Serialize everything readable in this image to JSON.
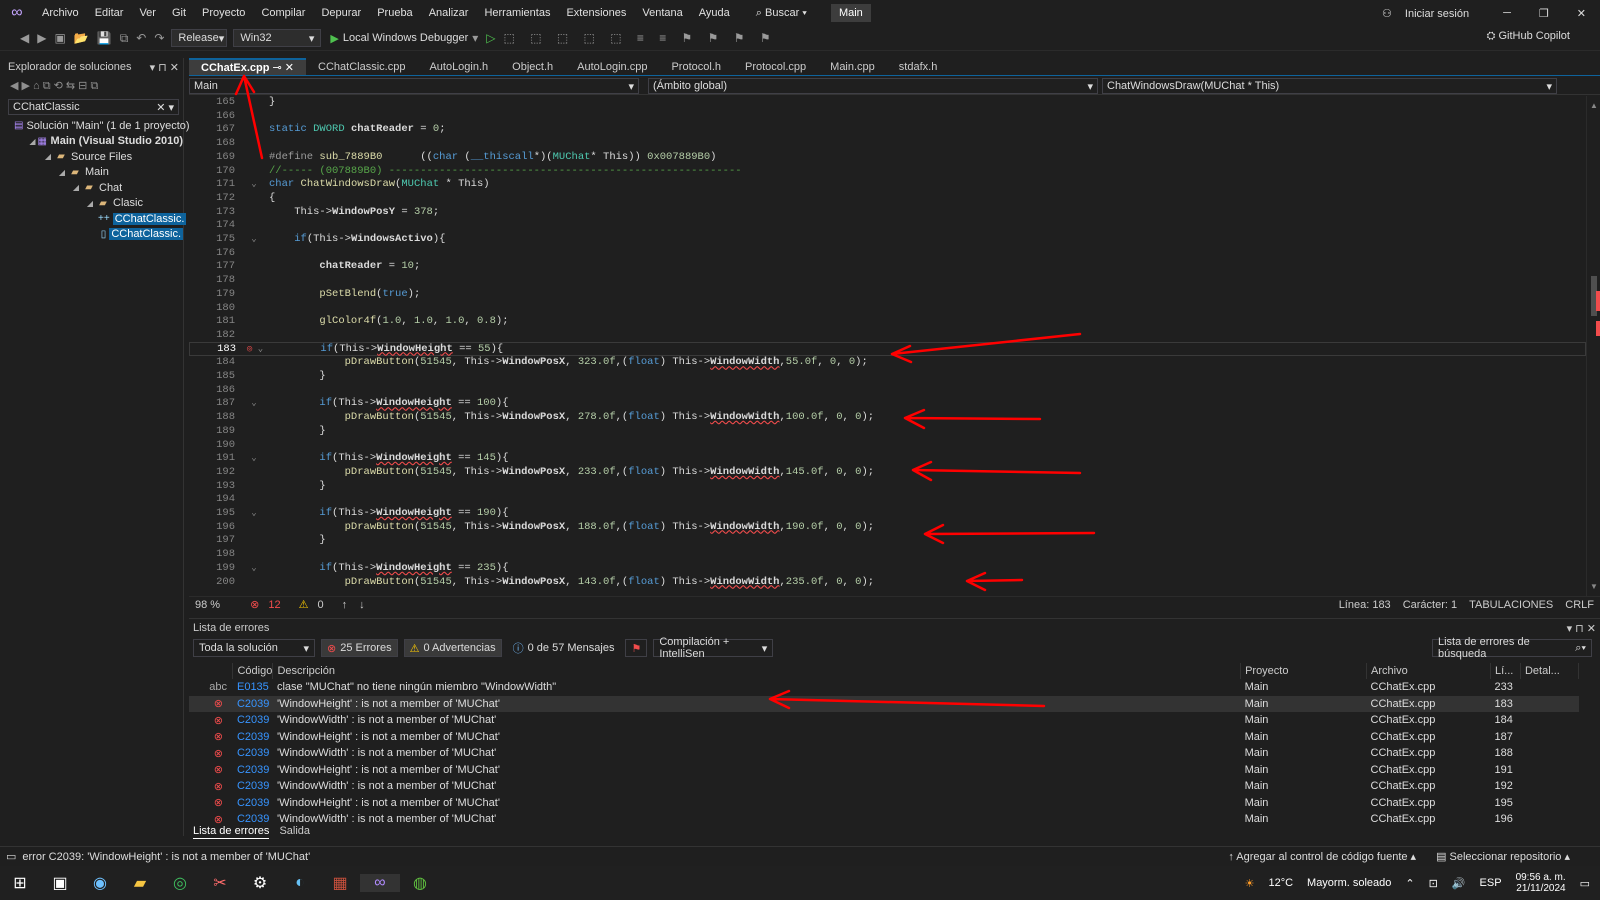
{
  "menubar": {
    "items": [
      "Archivo",
      "Editar",
      "Ver",
      "Git",
      "Proyecto",
      "Compilar",
      "Depurar",
      "Prueba",
      "Analizar",
      "Herramientas",
      "Extensiones",
      "Ventana",
      "Ayuda"
    ],
    "search": "Buscar",
    "solution": "Main",
    "signin": "Iniciar sesión"
  },
  "toolbar": {
    "config": "Release",
    "platform": "Win32",
    "debugger": "Local Windows Debugger",
    "copilot": "GitHub Copilot"
  },
  "sidebar": {
    "title": "Explorador de soluciones",
    "search_value": "CChatClassic",
    "tree": [
      {
        "label": "Solución \"Main\" (1 de 1 proyecto)",
        "indent": 0,
        "expander": "",
        "icon": "solution"
      },
      {
        "label": "Main (Visual Studio 2010)",
        "indent": 1,
        "expander": "◢",
        "icon": "project"
      },
      {
        "label": "Source Files",
        "indent": 2,
        "expander": "◢",
        "icon": "folder"
      },
      {
        "label": "Main",
        "indent": 3,
        "expander": "◢",
        "icon": "folder"
      },
      {
        "label": "Chat",
        "indent": 4,
        "expander": "◢",
        "icon": "folder"
      },
      {
        "label": "Clasic",
        "indent": 5,
        "expander": "◢",
        "icon": "folder"
      },
      {
        "label": "CChatClassic.",
        "indent": 6,
        "expander": "",
        "icon": "cpp",
        "selected": true
      },
      {
        "label": "CChatClassic.",
        "indent": 6,
        "expander": "",
        "icon": "h",
        "selected": true
      }
    ]
  },
  "tabs": [
    "CChatEx.cpp",
    "CChatClassic.cpp",
    "AutoLogin.h",
    "Object.h",
    "AutoLogin.cpp",
    "Protocol.h",
    "Protocol.cpp",
    "Main.cpp",
    "stdafx.h"
  ],
  "navbar": {
    "project": "Main",
    "scope": "(Ámbito global)",
    "member": "ChatWindowsDraw(MUChat * This)"
  },
  "statusline": {
    "zoom": "98 %",
    "errors": "12",
    "warnings": "0",
    "line": "Línea: 183",
    "char": "Carácter: 1",
    "tabs": "TABULACIONES",
    "eol": "CRLF"
  },
  "errors_panel": {
    "title": "Lista de errores",
    "scope": "Toda la solución",
    "errors": "25 Errores",
    "warnings": "0 Advertencias",
    "messages": "0 de 57 Mensajes",
    "build": "Compilación + IntelliSen",
    "search": "Lista de errores de búsqueda",
    "columns": [
      "Código",
      "Descripción",
      "Proyecto",
      "Archivo",
      "Lí...",
      "Detal..."
    ],
    "rows": [
      {
        "code": "E0135",
        "desc": "clase \"MUChat\" no tiene ningún miembro \"WindowWidth\"",
        "proj": "Main",
        "file": "CChatEx.cpp",
        "line": "233",
        "kind": "intellisense"
      },
      {
        "code": "C2039",
        "desc": "'WindowHeight' : is not a member of 'MUChat'",
        "proj": "Main",
        "file": "CChatEx.cpp",
        "line": "183",
        "kind": "error"
      },
      {
        "code": "C2039",
        "desc": "'WindowWidth' : is not a member of 'MUChat'",
        "proj": "Main",
        "file": "CChatEx.cpp",
        "line": "184",
        "kind": "error"
      },
      {
        "code": "C2039",
        "desc": "'WindowHeight' : is not a member of 'MUChat'",
        "proj": "Main",
        "file": "CChatEx.cpp",
        "line": "187",
        "kind": "error"
      },
      {
        "code": "C2039",
        "desc": "'WindowWidth' : is not a member of 'MUChat'",
        "proj": "Main",
        "file": "CChatEx.cpp",
        "line": "188",
        "kind": "error"
      },
      {
        "code": "C2039",
        "desc": "'WindowHeight' : is not a member of 'MUChat'",
        "proj": "Main",
        "file": "CChatEx.cpp",
        "line": "191",
        "kind": "error"
      },
      {
        "code": "C2039",
        "desc": "'WindowWidth' : is not a member of 'MUChat'",
        "proj": "Main",
        "file": "CChatEx.cpp",
        "line": "192",
        "kind": "error"
      },
      {
        "code": "C2039",
        "desc": "'WindowHeight' : is not a member of 'MUChat'",
        "proj": "Main",
        "file": "CChatEx.cpp",
        "line": "195",
        "kind": "error"
      },
      {
        "code": "C2039",
        "desc": "'WindowWidth' : is not a member of 'MUChat'",
        "proj": "Main",
        "file": "CChatEx.cpp",
        "line": "196",
        "kind": "error"
      }
    ],
    "tabs": [
      "Lista de errores",
      "Salida"
    ]
  },
  "statusbar": {
    "message": "error C2039: 'WindowHeight' : is not a member of 'MUChat'",
    "source_control": "Agregar al control de código fuente",
    "repo": "Seleccionar repositorio"
  },
  "taskbar": {
    "temp": "12°C",
    "weather": "Mayorm. soleado",
    "lang": "ESP",
    "time": "09:56 a. m.",
    "date": "21/11/2024"
  },
  "colors": {
    "accent": "#0e639c",
    "error": "#f14c4c",
    "annotation_arrow": "#ff0000"
  },
  "code": [
    {
      "n": "165",
      "t": "}"
    },
    {
      "n": "166",
      "t": ""
    },
    {
      "n": "167",
      "t": "static DWORD chatReader = 0;"
    },
    {
      "n": "168",
      "t": ""
    },
    {
      "n": "169",
      "t": "#define sub_7889B0      ((char (__thiscall*)(MUChat* This)) 0x007889B0)"
    },
    {
      "n": "170",
      "t": "//----- (007889B0) --------------------------------------------------------"
    },
    {
      "n": "171",
      "t": "char ChatWindowsDraw(MUChat * This)"
    },
    {
      "n": "172",
      "t": "{"
    },
    {
      "n": "173",
      "t": "    This->WindowPosY = 378;"
    },
    {
      "n": "174",
      "t": ""
    },
    {
      "n": "175",
      "t": "    if(This->WindowsActivo){"
    },
    {
      "n": "176",
      "t": ""
    },
    {
      "n": "177",
      "t": "        chatReader = 10;"
    },
    {
      "n": "178",
      "t": ""
    },
    {
      "n": "179",
      "t": "        pSetBlend(true);"
    },
    {
      "n": "180",
      "t": ""
    },
    {
      "n": "181",
      "t": "        glColor4f(1.0, 1.0, 1.0, 0.8);"
    },
    {
      "n": "182",
      "t": ""
    },
    {
      "n": "183",
      "t": "        if(This->WindowHeight == 55){"
    },
    {
      "n": "184",
      "t": "            pDrawButton(51545, This->WindowPosX, 323.0f,(float) This->WindowWidth,55.0f, 0, 0);"
    },
    {
      "n": "185",
      "t": "        }"
    },
    {
      "n": "186",
      "t": ""
    },
    {
      "n": "187",
      "t": "        if(This->WindowHeight == 100){"
    },
    {
      "n": "188",
      "t": "            pDrawButton(51545, This->WindowPosX, 278.0f,(float) This->WindowWidth,100.0f, 0, 0);"
    },
    {
      "n": "189",
      "t": "        }"
    },
    {
      "n": "190",
      "t": ""
    },
    {
      "n": "191",
      "t": "        if(This->WindowHeight == 145){"
    },
    {
      "n": "192",
      "t": "            pDrawButton(51545, This->WindowPosX, 233.0f,(float) This->WindowWidth,145.0f, 0, 0);"
    },
    {
      "n": "193",
      "t": "        }"
    },
    {
      "n": "194",
      "t": ""
    },
    {
      "n": "195",
      "t": "        if(This->WindowHeight == 190){"
    },
    {
      "n": "196",
      "t": "            pDrawButton(51545, This->WindowPosX, 188.0f,(float) This->WindowWidth,190.0f, 0, 0);"
    },
    {
      "n": "197",
      "t": "        }"
    },
    {
      "n": "198",
      "t": ""
    },
    {
      "n": "199",
      "t": "        if(This->WindowHeight == 235){"
    },
    {
      "n": "200",
      "t": "            pDrawButton(51545, This->WindowPosX, 143.0f,(float) This->WindowWidth,235.0f, 0, 0);"
    }
  ]
}
